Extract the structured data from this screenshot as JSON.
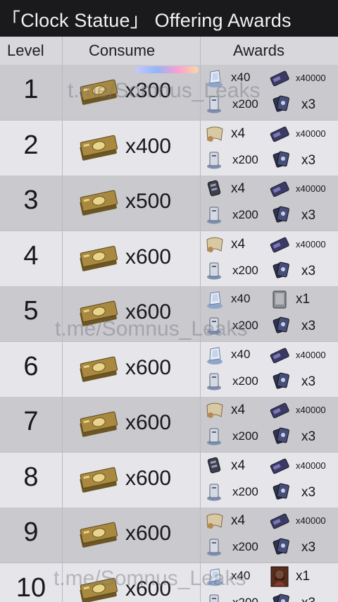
{
  "title": "「Clock Statue」 Offering Awards",
  "headers": {
    "level": "Level",
    "consume": "Consume",
    "awards": "Awards"
  },
  "watermark": "t.me/Somnus_Leaks",
  "rows": [
    {
      "level": "1",
      "consume_qty": "x300",
      "a1_icon": "crystal-icon",
      "a1_qty": "x40",
      "a2_icon": "card-icon",
      "a2_qty": "x40000",
      "a3_icon": "pillar-icon",
      "a3_qty": "x200",
      "a4_icon": "cards-icon",
      "a4_qty": "x3"
    },
    {
      "level": "2",
      "consume_qty": "x400",
      "a1_icon": "scroll-icon",
      "a1_qty": "x4",
      "a2_icon": "card-icon",
      "a2_qty": "x40000",
      "a3_icon": "pillar-icon",
      "a3_qty": "x200",
      "a4_icon": "cards-icon",
      "a4_qty": "x3"
    },
    {
      "level": "3",
      "consume_qty": "x500",
      "a1_icon": "gauntlet-icon",
      "a1_qty": "x4",
      "a2_icon": "card-icon",
      "a2_qty": "x40000",
      "a3_icon": "pillar-icon",
      "a3_qty": "x200",
      "a4_icon": "cards-icon",
      "a4_qty": "x3"
    },
    {
      "level": "4",
      "consume_qty": "x600",
      "a1_icon": "scroll-icon",
      "a1_qty": "x4",
      "a2_icon": "card-icon",
      "a2_qty": "x40000",
      "a3_icon": "pillar-icon",
      "a3_qty": "x200",
      "a4_icon": "cards-icon",
      "a4_qty": "x3"
    },
    {
      "level": "5",
      "consume_qty": "x600",
      "a1_icon": "crystal-icon",
      "a1_qty": "x40",
      "a2_icon": "tablet-icon",
      "a2_qty": "x1",
      "a3_icon": "pillar-icon",
      "a3_qty": "x200",
      "a4_icon": "cards-icon",
      "a4_qty": "x3"
    },
    {
      "level": "6",
      "consume_qty": "x600",
      "a1_icon": "crystal-icon",
      "a1_qty": "x40",
      "a2_icon": "card-icon",
      "a2_qty": "x40000",
      "a3_icon": "pillar-icon",
      "a3_qty": "x200",
      "a4_icon": "cards-icon",
      "a4_qty": "x3"
    },
    {
      "level": "7",
      "consume_qty": "x600",
      "a1_icon": "scroll-icon",
      "a1_qty": "x4",
      "a2_icon": "card-icon",
      "a2_qty": "x40000",
      "a3_icon": "pillar-icon",
      "a3_qty": "x200",
      "a4_icon": "cards-icon",
      "a4_qty": "x3"
    },
    {
      "level": "8",
      "consume_qty": "x600",
      "a1_icon": "gauntlet-icon",
      "a1_qty": "x4",
      "a2_icon": "card-icon",
      "a2_qty": "x40000",
      "a3_icon": "pillar-icon",
      "a3_qty": "x200",
      "a4_icon": "cards-icon",
      "a4_qty": "x3"
    },
    {
      "level": "9",
      "consume_qty": "x600",
      "a1_icon": "scroll-icon",
      "a1_qty": "x4",
      "a2_icon": "card-icon",
      "a2_qty": "x40000",
      "a3_icon": "pillar-icon",
      "a3_qty": "x200",
      "a4_icon": "cards-icon",
      "a4_qty": "x3"
    },
    {
      "level": "10",
      "consume_qty": "x600",
      "a1_icon": "crystal-icon",
      "a1_qty": "x40",
      "a2_icon": "portrait-icon",
      "a2_qty": "x1",
      "a3_icon": "pillar-icon",
      "a3_qty": "x200",
      "a4_icon": "cards-icon",
      "a4_qty": "x3"
    }
  ],
  "colors": {
    "title_bg": "#1a1a1d",
    "row_dark": "#c9c9ce",
    "row_light": "#e6e6ea",
    "text": "#18181b"
  }
}
